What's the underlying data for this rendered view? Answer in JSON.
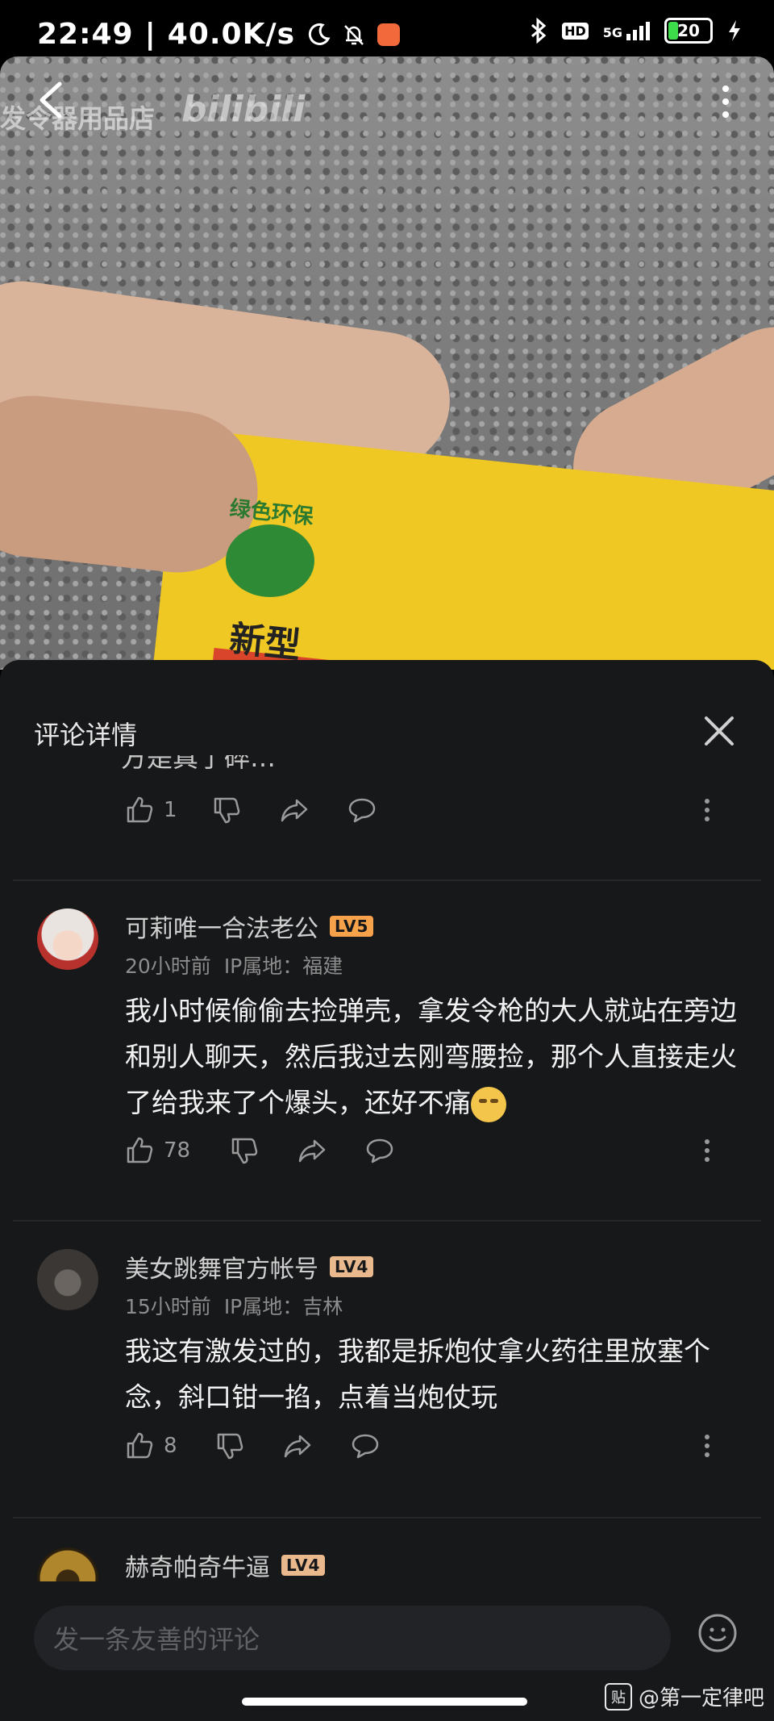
{
  "status_bar": {
    "time": "22:49",
    "net_speed": "40.0K/s",
    "network": "5G",
    "hd": "HD",
    "battery": "20"
  },
  "video": {
    "watermark_shop": "发令器用品店",
    "watermark_brand": "bilibili",
    "box_label_top": "绿色环保",
    "box_label_main": "新型"
  },
  "panel": {
    "title": "评论详情",
    "clipped_text": "方是真了碎…",
    "first_actions": {
      "likes": "1"
    }
  },
  "comments": [
    {
      "username": "可莉唯一合法老公",
      "level": "LV5",
      "level_color": "#f6a24a",
      "time": "20小时前",
      "ip": "IP属地：福建",
      "text": "我小时候偷偷去捡弹壳，拿发令枪的大人就站在旁边和别人聊天，然后我过去刚弯腰捡，那个人直接走火了给我来了个爆头，还好不痛",
      "likes": "78"
    },
    {
      "username": "美女跳舞官方帐号",
      "level": "LV4",
      "level_color": "#e9b98d",
      "time": "15小时前",
      "ip": "IP属地：吉林",
      "text": "我这有激发过的，我都是拆炮仗拿火药往里放塞个念，斜口钳一掐，点着当炮仗玩",
      "likes": "8"
    },
    {
      "username": "赫奇帕奇牛逼",
      "level": "LV4",
      "level_color": "#e9b98d"
    }
  ],
  "input": {
    "placeholder": "发一条友善的评论"
  },
  "credit": {
    "icon_text": "贴",
    "text": "@第一定律吧"
  }
}
